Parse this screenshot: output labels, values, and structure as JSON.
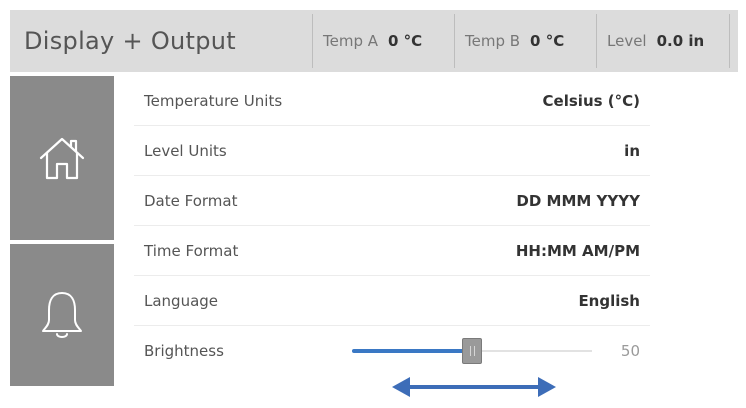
{
  "header": {
    "title": "Display + Output",
    "readouts": [
      {
        "label": "Temp A",
        "value": "0 °C"
      },
      {
        "label": "Temp B",
        "value": "0 °C"
      },
      {
        "label": "Level",
        "value": "0.0 in"
      }
    ]
  },
  "nav": {
    "items": [
      {
        "icon": "home-icon"
      },
      {
        "icon": "bell-icon"
      }
    ]
  },
  "settings": {
    "rows": [
      {
        "label": "Temperature Units",
        "value": "Celsius (°C)"
      },
      {
        "label": "Level Units",
        "value": "in"
      },
      {
        "label": "Date Format",
        "value": "DD MMM YYYY"
      },
      {
        "label": "Time Format",
        "value": "HH:MM AM/PM"
      },
      {
        "label": "Language",
        "value": "English"
      }
    ],
    "brightness": {
      "label": "Brightness",
      "value": "50",
      "fraction": 0.5
    }
  },
  "colors": {
    "header_bg": "#dcdcdc",
    "nav_bg": "#8a8a8a",
    "accent": "#3a78c4",
    "arrow": "#3d6db8"
  },
  "hint": {
    "icon": "double-arrow-icon"
  }
}
